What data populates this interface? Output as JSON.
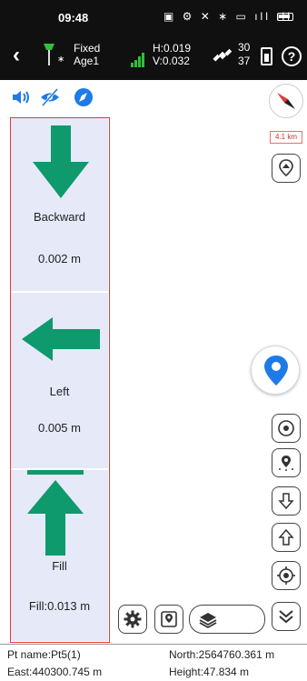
{
  "status_bar": {
    "time": "09:48",
    "icons": [
      "nfc-icon",
      "alarm-icon",
      "mute-icon",
      "bluetooth-icon",
      "nfc-tag-icon",
      "signal-icon",
      "signal-icon",
      "battery-icon"
    ]
  },
  "header": {
    "solution": "Fixed",
    "age": "Age1",
    "h_rms": "H:0.019",
    "v_rms": "V:0.032",
    "satellites_used": "30",
    "satellites_seen": "37"
  },
  "panel": {
    "sections": [
      {
        "direction": "Backward",
        "value": "0.002 m"
      },
      {
        "direction": "Left",
        "value": "0.005 m"
      },
      {
        "direction": "Fill",
        "value": "Fill:0.013 m"
      }
    ]
  },
  "map": {
    "scale": "4.1 km"
  },
  "point_info": {
    "pt_name": "Pt name:Pt5(1)",
    "north": "North:2564760.361 m",
    "east": "East:440300.745 m",
    "height": "Height:47.834 m"
  },
  "colors": {
    "arrow_green": "#0e9a6c",
    "accent_blue": "#1e7be6",
    "panel_bg": "#e5e9f8",
    "panel_border": "#e53935"
  }
}
